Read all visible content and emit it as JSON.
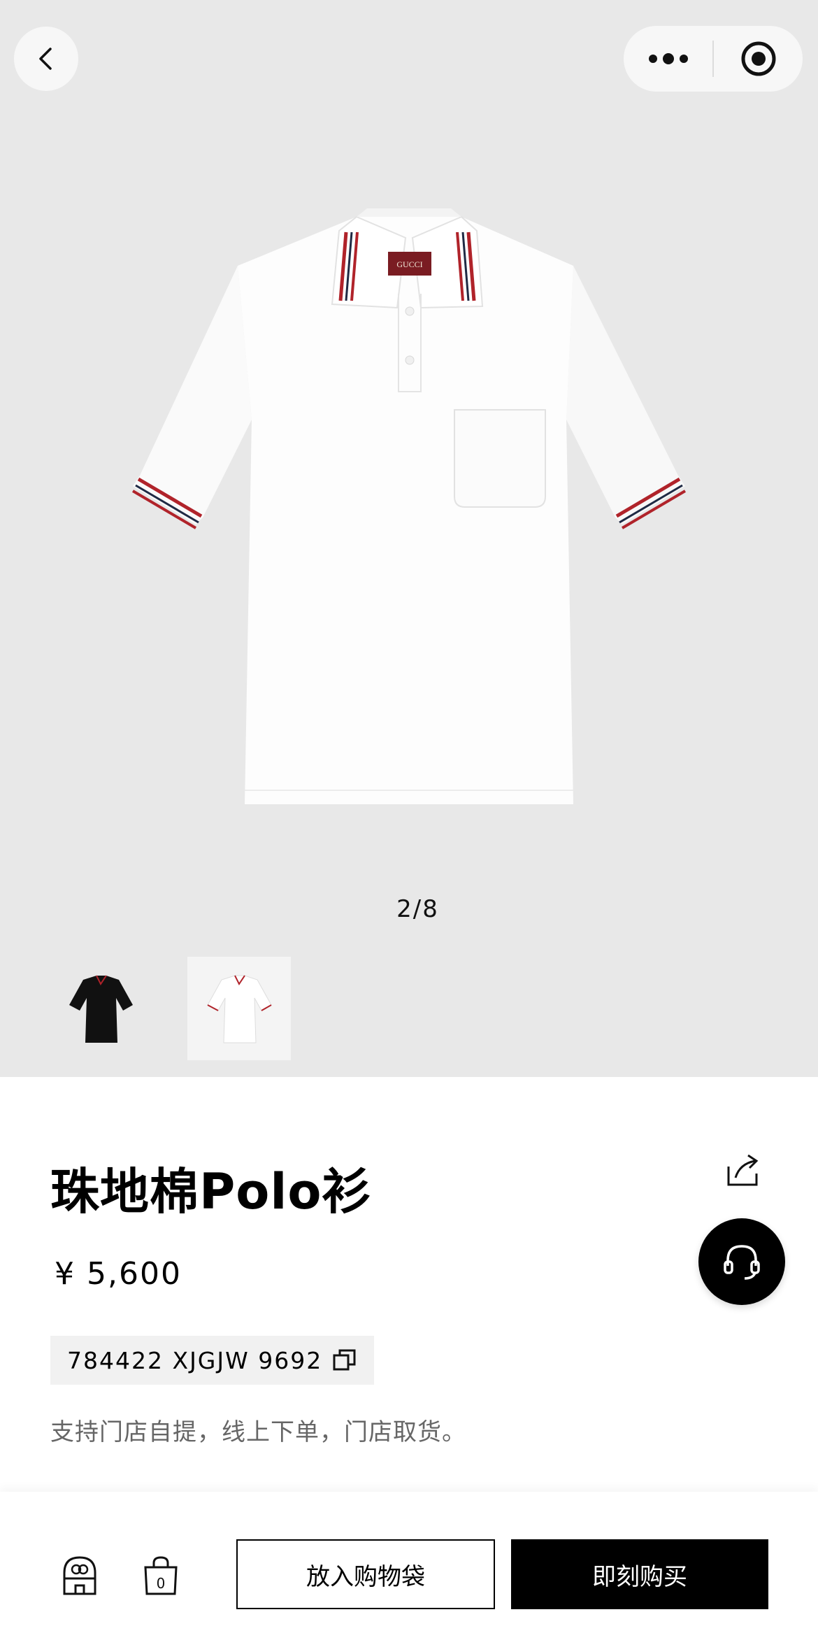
{
  "gallery": {
    "counter": "2/8",
    "thumbnails": [
      {
        "name": "black-polo-thumbnail",
        "color": "#111111"
      },
      {
        "name": "white-polo-thumbnail",
        "color": "#ffffff"
      }
    ]
  },
  "product": {
    "title": "珠地棉Polo衫",
    "price": "¥ 5,600",
    "sku": "784422 XJGJW 9692",
    "pickup_note": "支持门店自提，线上下单，门店取货。",
    "brand_label": "GUCCI"
  },
  "actions": {
    "add_to_bag": "放入购物袋",
    "buy_now": "即刻购买",
    "bag_count": "0"
  },
  "colors": {
    "stripe_red": "#b0232a",
    "stripe_navy": "#1f2a44",
    "gallery_bg": "#e8e8e8"
  }
}
